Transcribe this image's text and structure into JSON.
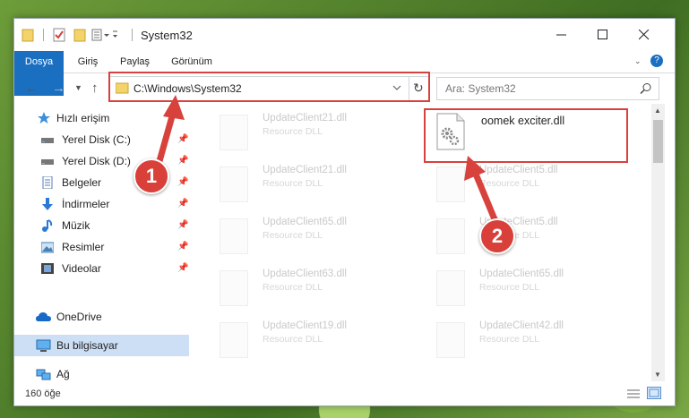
{
  "window": {
    "title": "System32"
  },
  "ribbon": {
    "tabs": [
      "Dosya",
      "Giriş",
      "Paylaş",
      "Görünüm"
    ]
  },
  "address": {
    "path": "C:\\Windows\\System32",
    "search_placeholder": "Ara: System32"
  },
  "sidebar": {
    "items": [
      {
        "label": "Hızlı erişim",
        "icon": "star-icon",
        "pinned": false
      },
      {
        "label": "Yerel Disk (C:)",
        "icon": "drive-icon",
        "pinned": true
      },
      {
        "label": "Yerel Disk (D:)",
        "icon": "drive-icon",
        "pinned": true
      },
      {
        "label": "Belgeler",
        "icon": "documents-icon",
        "pinned": true
      },
      {
        "label": "İndirmeler",
        "icon": "download-icon",
        "pinned": true
      },
      {
        "label": "Müzik",
        "icon": "music-icon",
        "pinned": true
      },
      {
        "label": "Resimler",
        "icon": "pictures-icon",
        "pinned": true
      },
      {
        "label": "Videolar",
        "icon": "videos-icon",
        "pinned": true
      },
      {
        "label": "OneDrive",
        "icon": "cloud-icon",
        "pinned": false
      },
      {
        "label": "Bu bilgisayar",
        "icon": "computer-icon",
        "pinned": false,
        "selected": true
      },
      {
        "label": "Ağ",
        "icon": "network-icon",
        "pinned": false
      }
    ]
  },
  "files": {
    "left": [
      {
        "name": "UpdateClient21.dll",
        "type": "Resource DLL"
      },
      {
        "name": "UpdateClient21.dll",
        "type": "Resource DLL"
      },
      {
        "name": "UpdateClient65.dll",
        "type": "Resource DLL"
      },
      {
        "name": "UpdateClient63.dll",
        "type": "Resource DLL"
      },
      {
        "name": "UpdateClient19.dll",
        "type": "Resource DLL"
      }
    ],
    "right": [
      {
        "name": "oomek exciter.dll",
        "type": "",
        "highlight": true
      },
      {
        "name": "UpdateClient5.dll",
        "type": "Resource DLL"
      },
      {
        "name": "UpdateClient5.dll",
        "type": "Resource DLL"
      },
      {
        "name": "UpdateClient65.dll",
        "type": "Resource DLL"
      },
      {
        "name": "UpdateClient42.dll",
        "type": "Resource DLL"
      }
    ]
  },
  "status": {
    "count": "160 öğe"
  },
  "annotations": {
    "step1": "1",
    "step2": "2",
    "color": "#d8423c"
  }
}
